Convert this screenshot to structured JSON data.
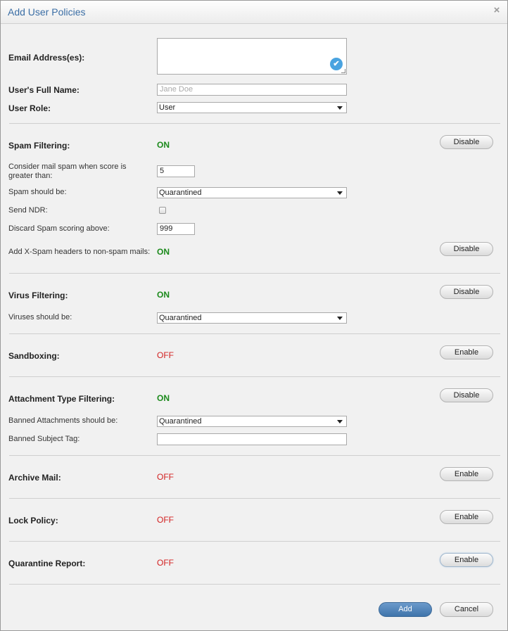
{
  "dialog": {
    "title": "Add User Policies",
    "close_glyph": "×",
    "close_icon": "close-icon"
  },
  "user": {
    "email_label": "Email Address(es):",
    "email_value": "",
    "email_validate_icon": "check-circle-icon",
    "fullname_label": "User's Full Name:",
    "fullname_placeholder": "Jane Doe",
    "role_label": "User Role:",
    "role_value": "User"
  },
  "spam": {
    "label": "Spam Filtering:",
    "status": "ON",
    "toggle_label": "Disable",
    "score_label": "Consider mail spam when score is greater than:",
    "score_value": "5",
    "action_label": "Spam should be:",
    "action_value": "Quarantined",
    "ndr_label": "Send NDR:",
    "ndr_checked": false,
    "discard_label": "Discard Spam scoring above:",
    "discard_value": "999",
    "xspam_label": "Add X-Spam headers to non-spam mails:",
    "xspam_status": "ON",
    "xspam_toggle_label": "Disable"
  },
  "virus": {
    "label": "Virus Filtering:",
    "status": "ON",
    "toggle_label": "Disable",
    "action_label": "Viruses should be:",
    "action_value": "Quarantined"
  },
  "sandboxing": {
    "label": "Sandboxing:",
    "status": "OFF",
    "toggle_label": "Enable"
  },
  "attachment": {
    "label": "Attachment Type Filtering:",
    "status": "ON",
    "toggle_label": "Disable",
    "action_label": "Banned Attachments should be:",
    "action_value": "Quarantined",
    "subject_tag_label": "Banned Subject Tag:",
    "subject_tag_value": ""
  },
  "archive": {
    "label": "Archive Mail:",
    "status": "OFF",
    "toggle_label": "Enable"
  },
  "lock": {
    "label": "Lock Policy:",
    "status": "OFF",
    "toggle_label": "Enable"
  },
  "quarantine_report": {
    "label": "Quarantine Report:",
    "status": "OFF",
    "toggle_label": "Enable"
  },
  "footer": {
    "add_label": "Add",
    "cancel_label": "Cancel"
  },
  "colors": {
    "on": "#1c8a1c",
    "off": "#d21f1f",
    "title": "#3b6ea5",
    "primary_button": "#4f82b8"
  }
}
